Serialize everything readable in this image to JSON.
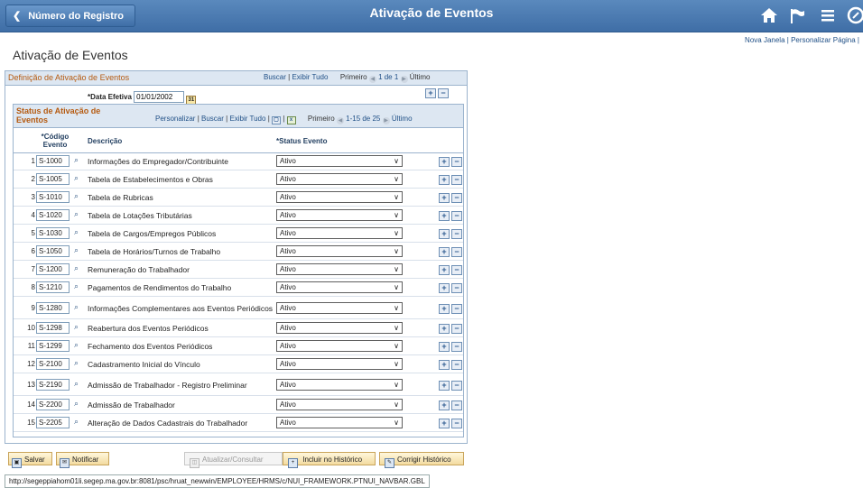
{
  "header": {
    "back_label": "Número do Registro",
    "title": "Ativação de Eventos",
    "icons": [
      "home-icon",
      "flag-icon",
      "menu-icon",
      "navbar-icon"
    ]
  },
  "toplinks": {
    "new_window": "Nova Janela",
    "sep": "|",
    "personalize": "Personalizar Página",
    "end": "|"
  },
  "page_title": "Ativação de Eventos",
  "definition": {
    "title": "Definição de Ativação de Eventos",
    "search": "Buscar",
    "view_all": "Exibir Tudo",
    "first": "Primeiro",
    "range": "1 de 1",
    "last": "Último",
    "effdt_label": "*Data Efetiva",
    "effdt_value": "01/01/2002"
  },
  "status_grid": {
    "title": "Status de Ativação de Eventos",
    "personalize": "Personalizar",
    "search": "Buscar",
    "view_all": "Exibir Tudo",
    "first": "Primeiro",
    "range": "1-15 de 25",
    "last": "Último",
    "col_code": "*Código Evento",
    "col_desc": "Descrição",
    "col_status": "*Status Evento",
    "rows": [
      {
        "n": "1",
        "code": "S-1000",
        "desc": "Informações do Empregador/Contribuinte",
        "status": "Ativo"
      },
      {
        "n": "2",
        "code": "S-1005",
        "desc": "Tabela de Estabelecimentos e Obras",
        "status": "Ativo"
      },
      {
        "n": "3",
        "code": "S-1010",
        "desc": "Tabela de Rubricas",
        "status": "Ativo"
      },
      {
        "n": "4",
        "code": "S-1020",
        "desc": "Tabela de Lotações Tributárias",
        "status": "Ativo"
      },
      {
        "n": "5",
        "code": "S-1030",
        "desc": "Tabela de Cargos/Empregos Públicos",
        "status": "Ativo"
      },
      {
        "n": "6",
        "code": "S-1050",
        "desc": "Tabela de Horários/Turnos de Trabalho",
        "status": "Ativo"
      },
      {
        "n": "7",
        "code": "S-1200",
        "desc": "Remuneração do Trabalhador",
        "status": "Ativo"
      },
      {
        "n": "8",
        "code": "S-1210",
        "desc": "Pagamentos de Rendimentos do Trabalho",
        "status": "Ativo"
      },
      {
        "n": "9",
        "code": "S-1280",
        "desc": "Informações Complementares aos Eventos Periódicos",
        "status": "Ativo"
      },
      {
        "n": "10",
        "code": "S-1298",
        "desc": "Reabertura dos Eventos Periódicos",
        "status": "Ativo"
      },
      {
        "n": "11",
        "code": "S-1299",
        "desc": "Fechamento dos Eventos Periódicos",
        "status": "Ativo"
      },
      {
        "n": "12",
        "code": "S-2100",
        "desc": "Cadastramento Inicial do Vínculo",
        "status": "Ativo"
      },
      {
        "n": "13",
        "code": "S-2190",
        "desc": "Admissão de Trabalhador - Registro Preliminar",
        "status": "Ativo"
      },
      {
        "n": "14",
        "code": "S-2200",
        "desc": "Admissão de Trabalhador",
        "status": "Ativo"
      },
      {
        "n": "15",
        "code": "S-2205",
        "desc": "Alteração de Dados Cadastrais do Trabalhador",
        "status": "Ativo"
      }
    ]
  },
  "buttons": {
    "save": "Salvar",
    "notify": "Notificar",
    "update": "Atualizar/Consultar",
    "history": "Incluir no Histórico",
    "correct": "Corrigir Histórico"
  },
  "status_url": "http://segeppiahom01li.segep.ma.gov.br:8081/psc/hruat_newwin/EMPLOYEE/HRMS/c/NUI_FRAMEWORK.PTNUI_NAVBAR.GBL"
}
